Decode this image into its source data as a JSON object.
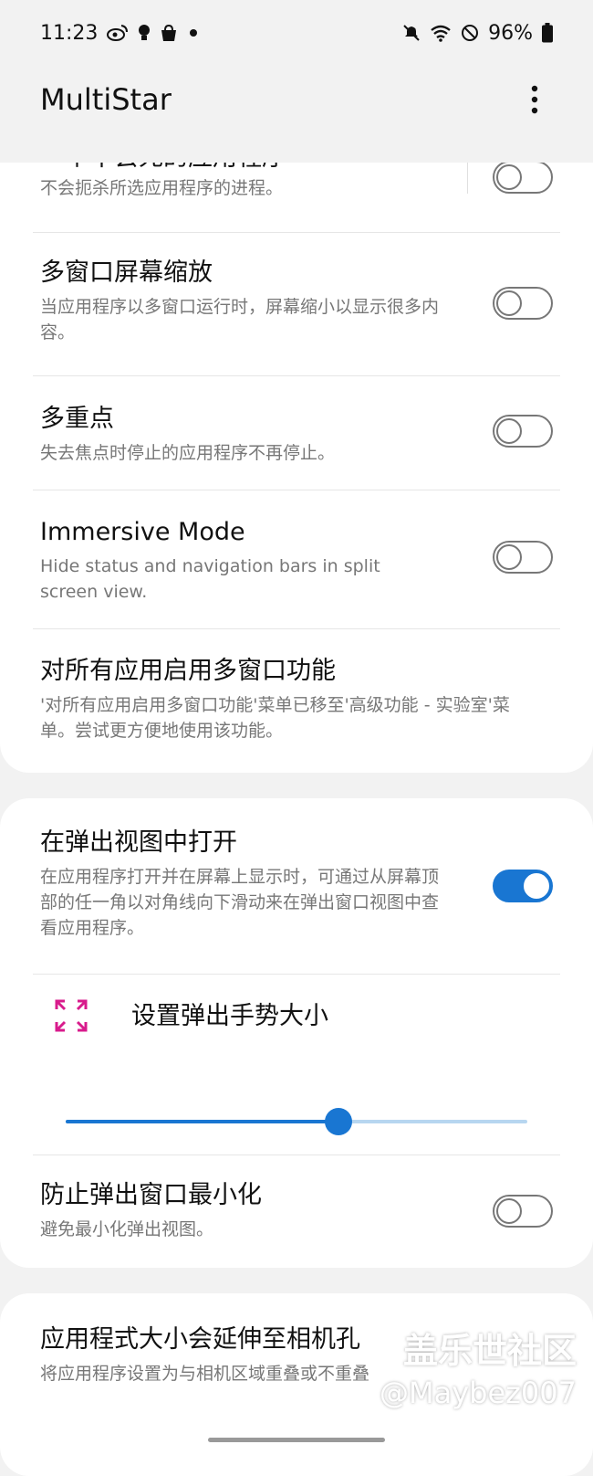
{
  "status_bar": {
    "time": "11:23",
    "left_icons": [
      "weibo-icon",
      "bulb-icon",
      "bag-icon",
      "dot-icon"
    ],
    "right_icons": [
      "mute-icon",
      "wifi-icon",
      "dnd-icon"
    ],
    "battery": "96%"
  },
  "app": {
    "title": "MultiStar",
    "menu_icon": "more-vert-icon"
  },
  "settings_card_1": {
    "items": [
      {
        "title": "一个不会死的应用程序",
        "subtitle": "不会扼杀所选应用程序的进程。",
        "toggle_on": false
      },
      {
        "title": "多窗口屏幕缩放",
        "subtitle": "当应用程序以多窗口运行时，屏幕缩小以显示很多内容。",
        "toggle_on": false
      },
      {
        "title": "多重点",
        "subtitle": "失去焦点时停止的应用程序不再停止。",
        "toggle_on": false
      },
      {
        "title": "Immersive Mode",
        "subtitle": "Hide status and navigation bars in split screen view.",
        "toggle_on": false
      },
      {
        "title": "对所有应用启用多窗口功能",
        "subtitle": "'对所有应用启用多窗口功能'菜单已移至'高级功能 - 实验室'菜单。尝试更方便地使用该功能。"
      }
    ]
  },
  "settings_card_2": {
    "popup": {
      "title": "在弹出视图中打开",
      "subtitle": "在应用程序打开并在屏幕上显示时，可通过从屏幕顶部的任一角以对角线向下滑动来在弹出窗口视图中查看应用程序。",
      "toggle_on": true
    },
    "gesture": {
      "icon": "expand-corners-icon",
      "label": "设置弹出手势大小",
      "slider_percent": 59
    },
    "prevent_minimize": {
      "title": "防止弹出窗口最小化",
      "subtitle": "避免最小化弹出视图。",
      "toggle_on": false
    }
  },
  "settings_card_3": {
    "item": {
      "title": "应用程式大小会延伸至相机孔",
      "subtitle": "将应用程序设置为与相机区域重叠或不重叠"
    }
  },
  "watermark": {
    "line1": "盖乐世社区",
    "line2": "@Maybez007"
  },
  "colors": {
    "accent": "#1976d2",
    "gesture_icon": "#d81b8c"
  }
}
